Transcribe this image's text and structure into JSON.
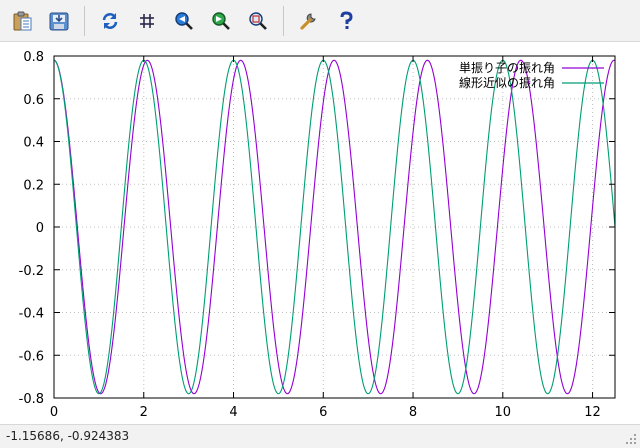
{
  "toolbar": {
    "buttons": [
      {
        "name": "copy-clipboard",
        "icon": "clipboard-icon"
      },
      {
        "name": "export",
        "icon": "export-icon"
      },
      {
        "name": "replot",
        "icon": "replot-icon"
      },
      {
        "name": "toggle-grid",
        "icon": "grid-icon"
      },
      {
        "name": "previous-zoom",
        "icon": "zoom-previous-icon"
      },
      {
        "name": "next-zoom",
        "icon": "zoom-next-icon"
      },
      {
        "name": "autoscale",
        "icon": "autoscale-icon"
      },
      {
        "name": "options",
        "icon": "wrench-icon"
      },
      {
        "name": "help",
        "icon": "help-icon"
      }
    ]
  },
  "status": {
    "coordinates": "-1.15686, -0.924383"
  },
  "chart_data": {
    "type": "line",
    "title": "",
    "xlabel": "",
    "ylabel": "",
    "xlim": [
      0,
      12.5
    ],
    "ylim": [
      -0.8,
      0.8
    ],
    "xticks": [
      0,
      2,
      4,
      6,
      8,
      10,
      12
    ],
    "yticks": [
      -0.8,
      -0.6,
      -0.4,
      -0.2,
      0,
      0.2,
      0.4,
      0.6,
      0.8
    ],
    "xtick_labels": [
      "0",
      "2",
      "4",
      "6",
      "8",
      "10",
      "12"
    ],
    "ytick_labels": [
      "-0.8",
      "-0.6",
      "-0.4",
      "-0.2",
      "0",
      "0.2",
      "0.4",
      "0.6",
      "0.8"
    ],
    "grid": true,
    "legend_position": "top-right",
    "series": [
      {
        "name": "単振り子の振れ角",
        "color": "#9400d3",
        "amplitude": 0.78,
        "period": 2.08,
        "phase": 0
      },
      {
        "name": "線形近似の振れ角",
        "color": "#009e73",
        "amplitude": 0.78,
        "period": 2.0,
        "phase": 0
      }
    ]
  }
}
